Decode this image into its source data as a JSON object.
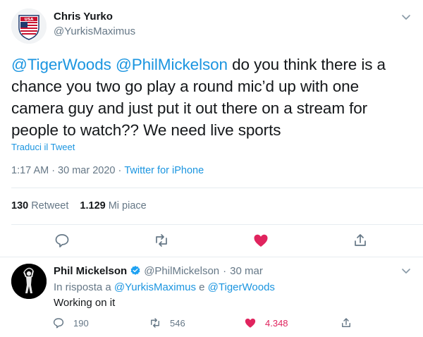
{
  "tweet": {
    "author_name": "Chris Yurko",
    "author_handle": "@YurkisMaximus",
    "avatar_flag_text": "USA",
    "mention1": "@TigerWoods",
    "mention2": "@PhilMickelson",
    "body": " do you think there is a chance you two go play a round mic’d up with one camera guy and just put it out there on a stream for people to watch?? We need live sports",
    "translate_label": "Traduci il Tweet",
    "time": "1:17 AM",
    "date": "30 mar 2020",
    "separator": "·",
    "source": "Twitter for iPhone",
    "retweet_count": "130",
    "retweet_label": "Retweet",
    "like_count": "1.129",
    "like_label": "Mi piace",
    "icons": [
      "reply-icon",
      "retweet-icon",
      "heart-icon",
      "share-icon"
    ],
    "liked": true
  },
  "reply": {
    "author_name": "Phil Mickelson",
    "author_handle": "@PhilMickelson",
    "separator": "·",
    "date": "30 mar",
    "in_reply_prefix": "In risposta a",
    "in_reply_user1": "@YurkisMaximus",
    "in_reply_and": "e",
    "in_reply_user2": "@TigerWoods",
    "body": "Working on it",
    "reply_count": "190",
    "retweet_count": "546",
    "like_count": "4.348",
    "verified": true
  },
  "colors": {
    "link": "#1b95e0",
    "secondary": "#657786",
    "like": "#e0245e",
    "divider": "#e6ecf0",
    "text": "#14171a"
  }
}
